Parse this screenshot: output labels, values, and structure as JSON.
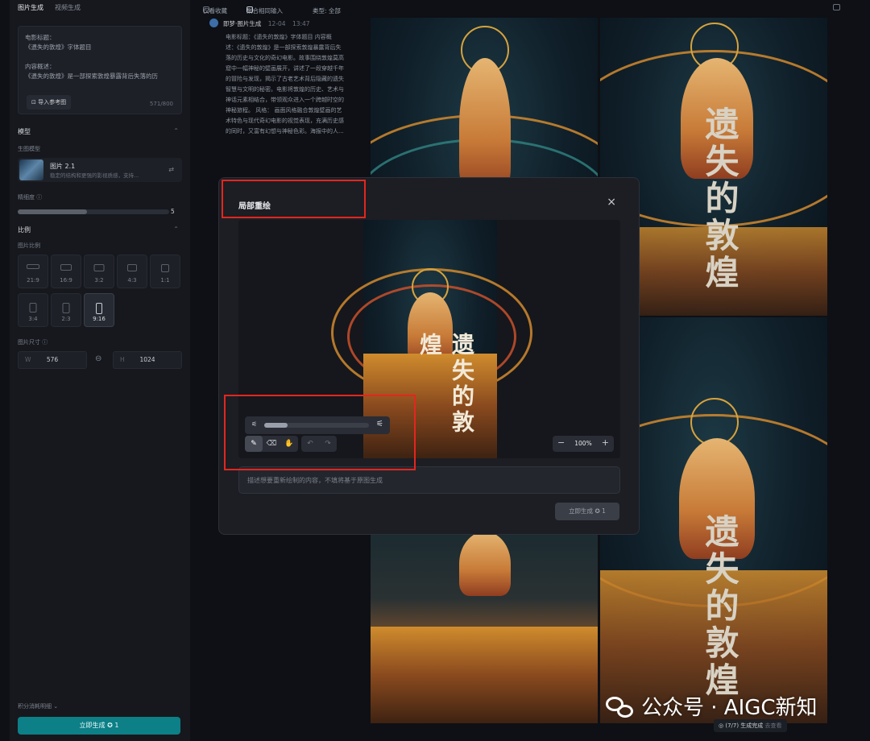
{
  "sidebar": {
    "tabs": [
      "图片生成",
      "视频生成"
    ],
    "prompt": {
      "lines": [
        "电影标题：",
        "《遗失的敦煌》字体题目",
        "",
        "内容概述：",
        "《遗失的敦煌》是一部探索敦煌暴露背后失落的历"
      ],
      "ref_button": "导入参考图",
      "char_count": "571/800"
    },
    "model_section": "模型",
    "model_label": "生图模型",
    "model_name": "图片 2.1",
    "model_desc": "稳定的结构和更强的影视质感，支持...",
    "fineness_label": "精细度",
    "fineness_value": "5",
    "fineness_level": 0.46,
    "ratio_section": "比例",
    "ratio_label": "图片比例",
    "ratios": [
      "21:9",
      "16:9",
      "3:2",
      "4:3",
      "1:1",
      "3:4",
      "2:3",
      "9:16"
    ],
    "active_ratio": "9:16",
    "size_label": "图片尺寸",
    "width_prefix": "W",
    "width": "576",
    "height_prefix": "H",
    "height": "1024",
    "points_detail": "积分消耗明细",
    "generate_label": "立即生成",
    "generate_cost": "1"
  },
  "topbar": {
    "only_fav": "仅看收藏",
    "merge_inputs": "聚合相同输入",
    "type_filter": "类型: 全部"
  },
  "record": {
    "source": "即梦·图片生成",
    "date": "12-04",
    "time": "13:47",
    "text_lines": [
      "电影标题：《遗失的敦煌》字体题目 内容概",
      "述：《遗失的敦煌》是一部探索敦煌暴露背后失",
      "落的历史与文化的奇幻电影。故事围绕敦煌莫高",
      "窟中一幅神秘的壁画展开，讲述了一段穿越千年",
      "的冒险与发现，揭示了古老艺术背后隐藏的遗失",
      "智慧与文明的秘密。电影将敦煌的历史、艺术与",
      "神话元素相结合，带领观众进入一个跨越时空的",
      "神秘旅程。 风格： 画面风格融合敦煌壁画的艺",
      "术特色与现代奇幻电影的视觉表现，充满历史感",
      "的同时，又富有幻想与神秘色彩。海报中的人..."
    ]
  },
  "poster_title": "遗失的敦煌",
  "modal": {
    "title": "局部重绘",
    "zoom": "100%",
    "brush_level": 0.22,
    "prompt_placeholder": "描述想要重新绘制的内容，不填将基于原图生成",
    "generate_label": "立即生成",
    "generate_cost": "1"
  },
  "footer": {
    "status": "(7/7) 生成完成",
    "view": "去查看"
  },
  "watermark": "公众号 · AIGC新知",
  "colors": {
    "accent": "#0d7f86",
    "highlight": "#e3261f",
    "background": "#0e1015"
  }
}
